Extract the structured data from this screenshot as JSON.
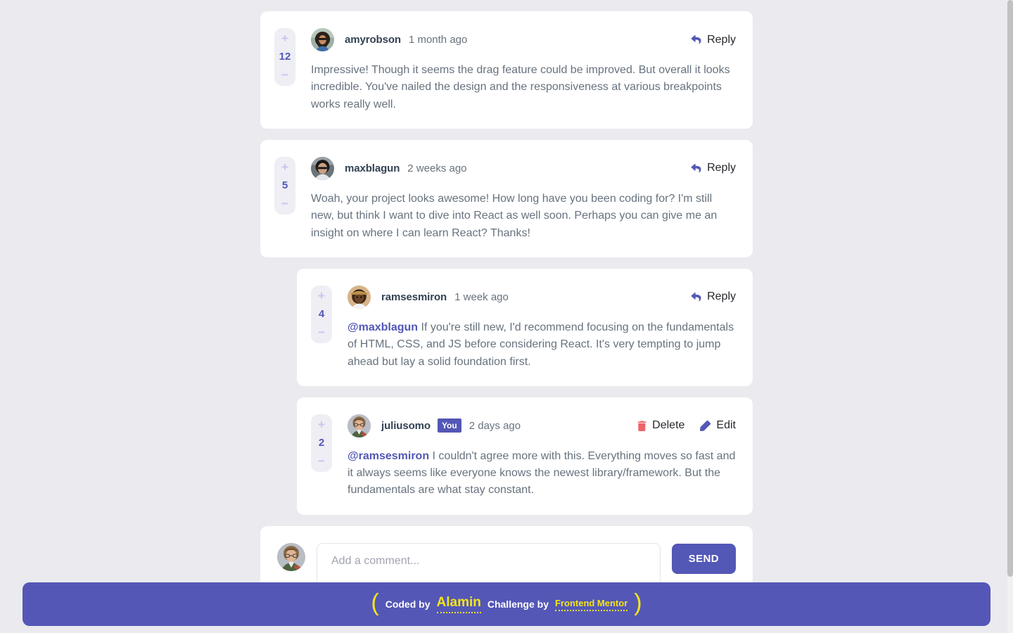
{
  "page": {
    "background_color": "#eaeaef",
    "accent_color": "#5357b6",
    "danger_color": "#ed6368"
  },
  "comments": [
    {
      "id": "amyrobson",
      "score": "12",
      "upvote": "+",
      "downvote": "−",
      "username": "amyrobson",
      "timestamp": "1 month ago",
      "action_reply": "Reply",
      "is_you": false,
      "mention": "",
      "text": "Impressive! Though it seems the drag feature could be improved. But overall it looks incredible. You've nailed the design and the responsiveness at various breakpoints works really well.",
      "avatar": "amyrobson-avatar"
    },
    {
      "id": "maxblagun",
      "score": "5",
      "upvote": "+",
      "downvote": "−",
      "username": "maxblagun",
      "timestamp": "2 weeks ago",
      "action_reply": "Reply",
      "is_you": false,
      "mention": "",
      "text": "Woah, your project looks awesome! How long have you been coding for? I'm still new, but think I want to dive into React as well soon. Perhaps you can give me an insight on where I can learn React? Thanks!",
      "avatar": "maxblagun-avatar"
    }
  ],
  "replies": [
    {
      "id": "ramsesmiron",
      "score": "4",
      "upvote": "+",
      "downvote": "−",
      "username": "ramsesmiron",
      "timestamp": "1 week ago",
      "action_reply": "Reply",
      "is_you": false,
      "mention": "@maxblagun",
      "text": " If you're still new, I'd recommend focusing on the fundamentals of HTML, CSS, and JS before considering React. It's very tempting to jump ahead but lay a solid foundation first.",
      "avatar": "ramsesmiron-avatar"
    },
    {
      "id": "juliusomo",
      "score": "2",
      "upvote": "+",
      "downvote": "−",
      "username": "juliusomo",
      "you_badge": "You",
      "timestamp": "2 days ago",
      "action_delete": "Delete",
      "action_edit": "Edit",
      "is_you": true,
      "mention": "@ramsesmiron",
      "text": " I couldn't agree more with this. Everything moves so fast and it always seems like everyone knows the newest library/framework. But the fundamentals are what stay constant.",
      "avatar": "juliusomo-avatar"
    }
  ],
  "add_comment": {
    "placeholder": "Add a comment...",
    "value": "",
    "send_label": "SEND",
    "avatar": "current-user-avatar"
  },
  "footer": {
    "open_paren": "(",
    "close_paren": ")",
    "coded_by_label": "Coded by",
    "coded_by_name": "Alamin",
    "challenge_by_label": "Challenge by",
    "challenge_by_name": "Frontend Mentor"
  }
}
